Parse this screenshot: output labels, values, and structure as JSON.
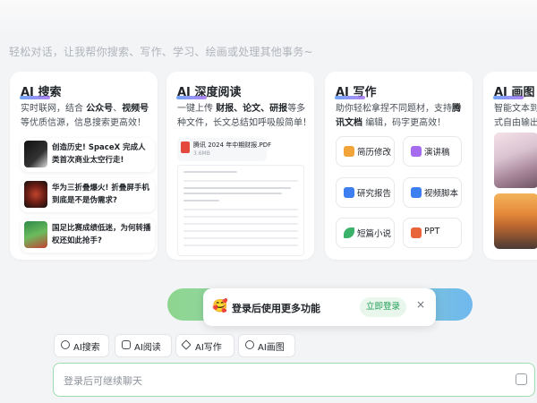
{
  "subtitle": "轻松对话，让我帮你搜索、写作、学习、绘画或处理其他事务~",
  "cards": {
    "search": {
      "title_prefix": "AI",
      "title": "搜索",
      "desc_part1": "实时联网，结合",
      "desc_bold1": "公众号",
      "desc_sep": "、",
      "desc_bold2": "视频号",
      "desc_line2": "等优质信源，信息搜索更高效！",
      "news": [
        {
          "text": "创造历史! SpaceX 完成人类首次商业太空行走!"
        },
        {
          "text": "华为三折叠爆火! 折叠屏手机到底是不是伪需求?"
        },
        {
          "text": "国足比赛成绩低迷，为何转播权还如此抢手?"
        }
      ]
    },
    "reading": {
      "title_prefix": "AI",
      "title": "深度阅读",
      "desc_part1": "一键上传",
      "desc_bold": "财报、论文、研报",
      "desc_part2": "等多种文件，长文总结如呼吸般简单！",
      "file_name": "腾讯 2024 年中期财报.PDF",
      "file_size": "3.6MB"
    },
    "writing": {
      "title_prefix": "AI",
      "title": "写作",
      "desc_part1": "助你轻松拿捏不同题材，支持",
      "desc_bold": "腾讯文档",
      "desc_part2": "编辑，码字更高效！",
      "buttons": [
        {
          "label": "简历修改",
          "icon": "resume-icon",
          "color": "#f2a33a"
        },
        {
          "label": "演讲稿",
          "icon": "speech-icon",
          "color": "#a66cf0"
        },
        {
          "label": "研究报告",
          "icon": "report-icon",
          "color": "#3d7ef0"
        },
        {
          "label": "视频脚本",
          "icon": "video-script-icon",
          "color": "#3d7ef0"
        },
        {
          "label": "短篇小说",
          "icon": "leaf-icon",
          "color": "#3bb26a"
        },
        {
          "label": "PPT",
          "icon": "ppt-icon",
          "color": "#e8643a"
        }
      ]
    },
    "painting": {
      "title_prefix": "AI",
      "title": "画图",
      "desc_line1": "智能文本到",
      "desc_line2": "式自由输出"
    }
  },
  "toast": {
    "emoji": "🥰",
    "message": "登录后使用更多功能",
    "login_label": "立即登录",
    "close_label": "×"
  },
  "quick_actions": [
    {
      "label": "AI搜索",
      "icon": "search-icon"
    },
    {
      "label": "AI阅读",
      "icon": "book-icon"
    },
    {
      "label": "AI写作",
      "icon": "pen-icon"
    },
    {
      "label": "AI画图",
      "icon": "palette-icon"
    }
  ],
  "input": {
    "placeholder": "登录后可继续聊天"
  }
}
